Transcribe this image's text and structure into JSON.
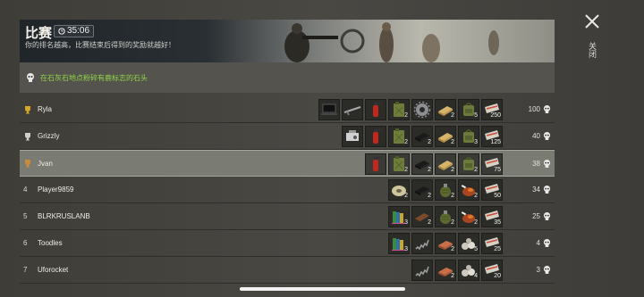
{
  "banner": {
    "title": "比赛",
    "timer": "35:06",
    "subtitle": "你的排名越高，比赛结束后得到的奖励就越好！"
  },
  "objective": {
    "text": "在石灰石地点粉碎有鹿标志的石头"
  },
  "close": {
    "label": "关闭"
  },
  "colors": {
    "objective_text": "#8fd24a",
    "highlight_row": "#7a7b73"
  },
  "rows": [
    {
      "rank": "trophy-gold",
      "name": "Ryla",
      "score": "100",
      "items": [
        {
          "icon": "laptop-icon",
          "count": ""
        },
        {
          "icon": "rifle-icon",
          "count": ""
        },
        {
          "icon": "fire-extinguisher-icon",
          "count": ""
        },
        {
          "icon": "jerrycan-icon",
          "count": "2"
        },
        {
          "icon": "gear-icon",
          "count": ""
        },
        {
          "icon": "plank-icon",
          "count": "2"
        },
        {
          "icon": "backpack-icon",
          "count": "5"
        },
        {
          "icon": "ticket-icon",
          "count": "250"
        }
      ]
    },
    {
      "rank": "trophy-silver",
      "name": "Grizzly",
      "score": "40",
      "items": [
        {
          "icon": "engine-icon",
          "count": ""
        },
        {
          "icon": "fire-extinguisher-icon",
          "count": ""
        },
        {
          "icon": "jerrycan-icon",
          "count": "2"
        },
        {
          "icon": "tire-icon",
          "count": "2"
        },
        {
          "icon": "plank-icon",
          "count": "2"
        },
        {
          "icon": "backpack-icon",
          "count": "3"
        },
        {
          "icon": "ticket-icon",
          "count": "125"
        }
      ]
    },
    {
      "rank": "trophy-bronze",
      "name": "Jvan",
      "score": "38",
      "items": [
        {
          "icon": "fire-extinguisher-icon",
          "count": ""
        },
        {
          "icon": "jerrycan-icon",
          "count": "2"
        },
        {
          "icon": "tire-icon",
          "count": "2"
        },
        {
          "icon": "plank-icon",
          "count": "2"
        },
        {
          "icon": "backpack-icon",
          "count": "2"
        },
        {
          "icon": "ticket-icon",
          "count": "75"
        }
      ]
    },
    {
      "rank": "4",
      "name": "Player9859",
      "score": "34",
      "items": [
        {
          "icon": "rope-spool-icon",
          "count": "2"
        },
        {
          "icon": "tire-icon",
          "count": "2"
        },
        {
          "icon": "grenade-icon",
          "count": "2"
        },
        {
          "icon": "meat-icon",
          "count": "2"
        },
        {
          "icon": "ticket-icon",
          "count": "50"
        }
      ]
    },
    {
      "rank": "5",
      "name": "BLRKRUSLANB",
      "score": "25",
      "items": [
        {
          "icon": "books-icon",
          "count": "3"
        },
        {
          "icon": "board-icon",
          "count": "2"
        },
        {
          "icon": "grenade-icon",
          "count": "2"
        },
        {
          "icon": "meat-icon",
          "count": "2"
        },
        {
          "icon": "ticket-icon",
          "count": "35"
        }
      ]
    },
    {
      "rank": "6",
      "name": "Toodles",
      "score": "4",
      "items": [
        {
          "icon": "books-icon",
          "count": "3"
        },
        {
          "icon": "spring-icon",
          "count": ""
        },
        {
          "icon": "brick-icon",
          "count": "2"
        },
        {
          "icon": "stones-icon",
          "count": "5"
        },
        {
          "icon": "ticket-icon",
          "count": "25"
        }
      ]
    },
    {
      "rank": "7",
      "name": "Uforocket",
      "score": "3",
      "items": [
        {
          "icon": "spring-icon",
          "count": ""
        },
        {
          "icon": "brick-icon",
          "count": "2"
        },
        {
          "icon": "stones-icon",
          "count": "4"
        },
        {
          "icon": "ticket-icon",
          "count": "20"
        }
      ]
    }
  ]
}
